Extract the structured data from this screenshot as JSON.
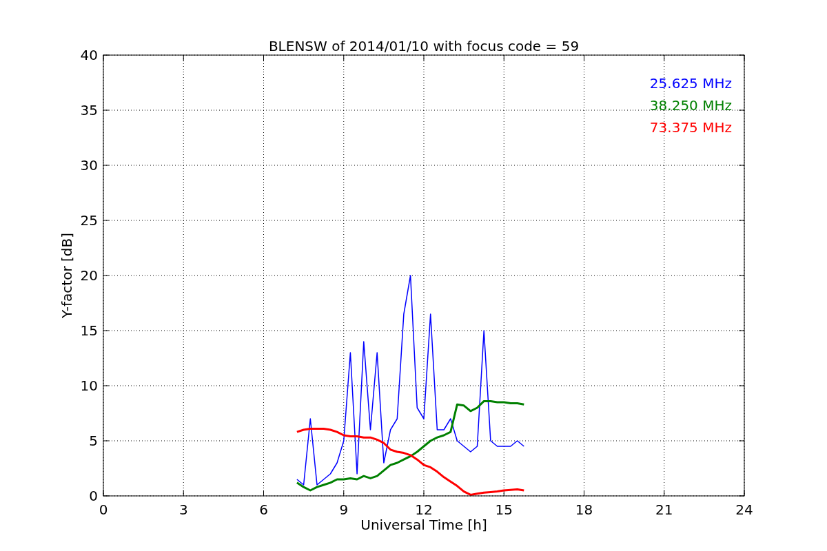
{
  "chart_data": {
    "type": "line",
    "title": "BLENSW of 2014/01/10 with focus code = 59",
    "xlabel": "Universal Time [h]",
    "ylabel": "Y-factor [dB]",
    "x": [
      7.25,
      7.5,
      7.75,
      8.0,
      8.25,
      8.5,
      8.75,
      9.0,
      9.25,
      9.5,
      9.75,
      10.0,
      10.25,
      10.5,
      10.75,
      11.0,
      11.25,
      11.5,
      11.75,
      12.0,
      12.25,
      12.5,
      12.75,
      13.0,
      13.25,
      13.5,
      13.75,
      14.0,
      14.25,
      14.5,
      14.75,
      15.0,
      15.25,
      15.5,
      15.75
    ],
    "series": [
      {
        "name": "25.625 MHz",
        "color": "#0000ff",
        "values": [
          1.5,
          1,
          7,
          1,
          1.5,
          2,
          3,
          5,
          13,
          2,
          14,
          6,
          13,
          3,
          6,
          7,
          16.5,
          20,
          8,
          7,
          16.5,
          6,
          6,
          7,
          5,
          4.5,
          4,
          4.5,
          15,
          5,
          4.5,
          4.5,
          4.5,
          5,
          4.5
        ]
      },
      {
        "name": "38.250 MHz",
        "color": "#008000",
        "values": [
          1.2,
          0.8,
          0.5,
          0.8,
          1,
          1.2,
          1.5,
          1.5,
          1.6,
          1.5,
          1.8,
          1.6,
          1.8,
          2.3,
          2.8,
          3,
          3.3,
          3.6,
          4,
          4.5,
          5,
          5.3,
          5.5,
          5.8,
          8.3,
          8.2,
          7.7,
          8,
          8.6,
          8.6,
          8.5,
          8.5,
          8.4,
          8.4,
          8.3
        ]
      },
      {
        "name": "73.375 MHz",
        "color": "#ff0000",
        "values": [
          5.8,
          6,
          6.1,
          6.1,
          6.1,
          6,
          5.8,
          5.5,
          5.4,
          5.4,
          5.3,
          5.3,
          5.1,
          4.8,
          4.2,
          4,
          3.9,
          3.7,
          3.3,
          2.8,
          2.6,
          2.2,
          1.7,
          1.3,
          0.9,
          0.4,
          0.1,
          0.2,
          0.3,
          0.35,
          0.4,
          0.5,
          0.55,
          0.6,
          0.5
        ]
      }
    ],
    "xlim": [
      0,
      24
    ],
    "ylim": [
      0,
      40
    ],
    "xticks": [
      0,
      3,
      6,
      9,
      12,
      15,
      18,
      21,
      24
    ],
    "yticks": [
      0,
      5,
      10,
      15,
      20,
      25,
      30,
      35,
      40
    ],
    "grid": true
  }
}
